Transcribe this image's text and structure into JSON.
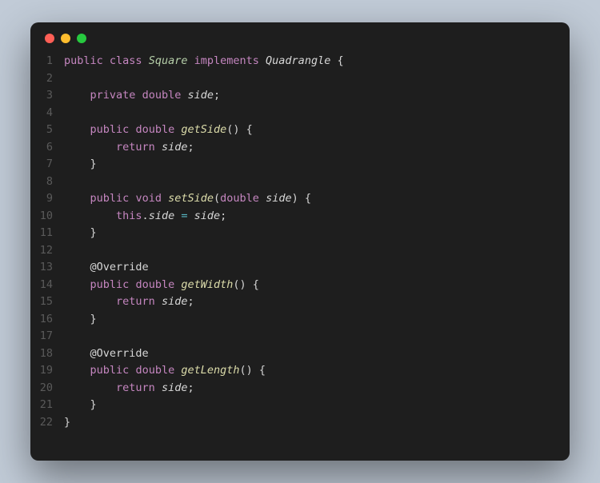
{
  "window": {
    "traffic_lights": [
      "red",
      "yellow",
      "green"
    ]
  },
  "code": {
    "language": "java",
    "lines": [
      {
        "n": 1,
        "indent": 0,
        "tokens": [
          {
            "t": "public",
            "c": "keyword"
          },
          {
            "t": " "
          },
          {
            "t": "class",
            "c": "keyword"
          },
          {
            "t": " "
          },
          {
            "t": "Square",
            "c": "classname"
          },
          {
            "t": " "
          },
          {
            "t": "implements",
            "c": "keyword"
          },
          {
            "t": " "
          },
          {
            "t": "Quadrangle",
            "c": "interface"
          },
          {
            "t": " "
          },
          {
            "t": "{",
            "c": "punct"
          }
        ]
      },
      {
        "n": 2,
        "indent": 0,
        "tokens": []
      },
      {
        "n": 3,
        "indent": 1,
        "tokens": [
          {
            "t": "private",
            "c": "keyword"
          },
          {
            "t": " "
          },
          {
            "t": "double",
            "c": "type"
          },
          {
            "t": " "
          },
          {
            "t": "side",
            "c": "var"
          },
          {
            "t": ";",
            "c": "punct"
          }
        ]
      },
      {
        "n": 4,
        "indent": 0,
        "tokens": []
      },
      {
        "n": 5,
        "indent": 1,
        "tokens": [
          {
            "t": "public",
            "c": "keyword"
          },
          {
            "t": " "
          },
          {
            "t": "double",
            "c": "type"
          },
          {
            "t": " "
          },
          {
            "t": "getSide",
            "c": "method"
          },
          {
            "t": "() {",
            "c": "punct"
          }
        ]
      },
      {
        "n": 6,
        "indent": 2,
        "tokens": [
          {
            "t": "return",
            "c": "keyword"
          },
          {
            "t": " "
          },
          {
            "t": "side",
            "c": "var"
          },
          {
            "t": ";",
            "c": "punct"
          }
        ]
      },
      {
        "n": 7,
        "indent": 1,
        "tokens": [
          {
            "t": "}",
            "c": "punct"
          }
        ]
      },
      {
        "n": 8,
        "indent": 0,
        "tokens": []
      },
      {
        "n": 9,
        "indent": 1,
        "tokens": [
          {
            "t": "public",
            "c": "keyword"
          },
          {
            "t": " "
          },
          {
            "t": "void",
            "c": "keyword"
          },
          {
            "t": " "
          },
          {
            "t": "setSide",
            "c": "method"
          },
          {
            "t": "(",
            "c": "punct"
          },
          {
            "t": "double",
            "c": "type"
          },
          {
            "t": " "
          },
          {
            "t": "side",
            "c": "var"
          },
          {
            "t": ") {",
            "c": "punct"
          }
        ]
      },
      {
        "n": 10,
        "indent": 2,
        "tokens": [
          {
            "t": "this",
            "c": "this"
          },
          {
            "t": ".",
            "c": "punct"
          },
          {
            "t": "side",
            "c": "var"
          },
          {
            "t": " "
          },
          {
            "t": "=",
            "c": "op"
          },
          {
            "t": " "
          },
          {
            "t": "side",
            "c": "var"
          },
          {
            "t": ";",
            "c": "punct"
          }
        ]
      },
      {
        "n": 11,
        "indent": 1,
        "tokens": [
          {
            "t": "}",
            "c": "punct"
          }
        ]
      },
      {
        "n": 12,
        "indent": 0,
        "tokens": []
      },
      {
        "n": 13,
        "indent": 1,
        "tokens": [
          {
            "t": "@Override",
            "c": "annot"
          }
        ]
      },
      {
        "n": 14,
        "indent": 1,
        "tokens": [
          {
            "t": "public",
            "c": "keyword"
          },
          {
            "t": " "
          },
          {
            "t": "double",
            "c": "type"
          },
          {
            "t": " "
          },
          {
            "t": "getWidth",
            "c": "method"
          },
          {
            "t": "() {",
            "c": "punct"
          }
        ]
      },
      {
        "n": 15,
        "indent": 2,
        "tokens": [
          {
            "t": "return",
            "c": "keyword"
          },
          {
            "t": " "
          },
          {
            "t": "side",
            "c": "var"
          },
          {
            "t": ";",
            "c": "punct"
          }
        ]
      },
      {
        "n": 16,
        "indent": 1,
        "tokens": [
          {
            "t": "}",
            "c": "punct"
          }
        ]
      },
      {
        "n": 17,
        "indent": 0,
        "tokens": []
      },
      {
        "n": 18,
        "indent": 1,
        "tokens": [
          {
            "t": "@Override",
            "c": "annot"
          }
        ]
      },
      {
        "n": 19,
        "indent": 1,
        "tokens": [
          {
            "t": "public",
            "c": "keyword"
          },
          {
            "t": " "
          },
          {
            "t": "double",
            "c": "type"
          },
          {
            "t": " "
          },
          {
            "t": "getLength",
            "c": "method"
          },
          {
            "t": "() {",
            "c": "punct"
          }
        ]
      },
      {
        "n": 20,
        "indent": 2,
        "tokens": [
          {
            "t": "return",
            "c": "keyword"
          },
          {
            "t": " "
          },
          {
            "t": "side",
            "c": "var"
          },
          {
            "t": ";",
            "c": "punct"
          }
        ]
      },
      {
        "n": 21,
        "indent": 1,
        "tokens": [
          {
            "t": "}",
            "c": "punct"
          }
        ]
      },
      {
        "n": 22,
        "indent": 0,
        "tokens": [
          {
            "t": "}",
            "c": "punct"
          }
        ]
      }
    ]
  }
}
